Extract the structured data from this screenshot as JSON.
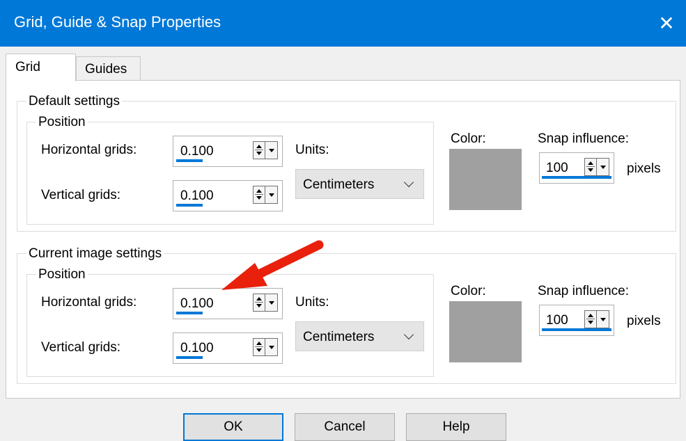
{
  "window": {
    "title": "Grid, Guide & Snap Properties",
    "close_icon": "close-icon"
  },
  "tabs": [
    {
      "label": "Grid",
      "active": true
    },
    {
      "label": "Guides",
      "active": false
    }
  ],
  "default_settings": {
    "label": "Default settings",
    "position_label": "Position",
    "horizontal_label": "Horizontal grids:",
    "horizontal_value": "0.100",
    "vertical_label": "Vertical grids:",
    "vertical_value": "0.100",
    "units_label": "Units:",
    "units_value": "Centimeters",
    "color_label": "Color:",
    "color_value": "#a0a0a0",
    "snap_label": "Snap influence:",
    "snap_value": "100",
    "snap_unit": "pixels"
  },
  "current_settings": {
    "label": "Current image settings",
    "position_label": "Position",
    "horizontal_label": "Horizontal grids:",
    "horizontal_value": "0.100",
    "vertical_label": "Vertical grids:",
    "vertical_value": "0.100",
    "units_label": "Units:",
    "units_value": "Centimeters",
    "color_label": "Color:",
    "color_value": "#a0a0a0",
    "snap_label": "Snap influence:",
    "snap_value": "100",
    "snap_unit": "pixels"
  },
  "buttons": {
    "ok": "OK",
    "cancel": "Cancel",
    "help": "Help"
  },
  "colors": {
    "accent": "#0078d7",
    "annotation_arrow": "#e8200c"
  }
}
